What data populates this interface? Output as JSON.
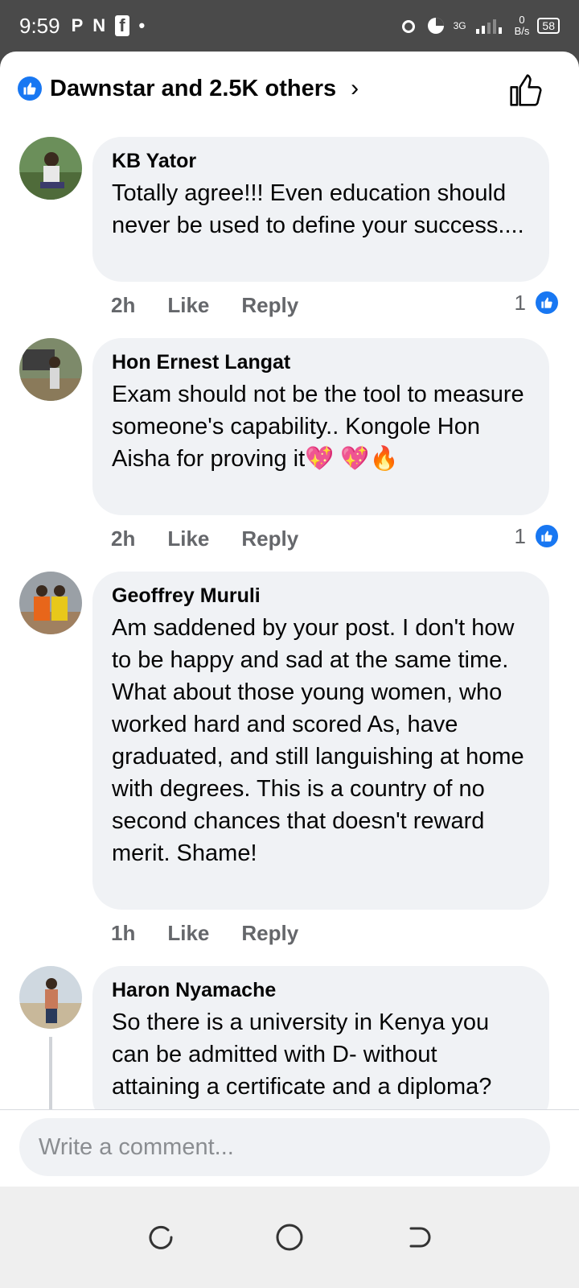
{
  "status_bar": {
    "time": "9:59",
    "left_icons": [
      "P",
      "N",
      "f",
      "•"
    ],
    "network": "3G",
    "speed_value": "0",
    "speed_unit": "B/s",
    "battery": "58"
  },
  "header": {
    "reactions_text": "Dawnstar and 2.5K others",
    "chevron": "›"
  },
  "comments": [
    {
      "author": "KB Yator",
      "text": "Totally agree!!! Even education should never be used to define your success....",
      "time": "2h",
      "like_label": "Like",
      "reply_label": "Reply",
      "reaction_count": "1"
    },
    {
      "author": "Hon Ernest Langat",
      "text": "Exam should not be the tool to measure someone's capability.. Kongole Hon Aisha for proving it💖 💖🔥",
      "time": "2h",
      "like_label": "Like",
      "reply_label": "Reply",
      "reaction_count": "1"
    },
    {
      "author": "Geoffrey Muruli",
      "text": "Am saddened by your post. I don't how to be happy and sad at the same time. What about those young women, who worked hard and scored As, have graduated, and still languishing at home with degrees. This is a country of no second chances that doesn't reward merit. Shame!",
      "time": "1h",
      "like_label": "Like",
      "reply_label": "Reply",
      "reaction_count": ""
    },
    {
      "author": "Haron Nyamache",
      "text": "So there is a university in Kenya you can be admitted with D- without attaining a certificate and a diploma?",
      "time": "",
      "like_label": "",
      "reply_label": "",
      "reaction_count": ""
    }
  ],
  "composer": {
    "placeholder": "Write a comment..."
  },
  "colors": {
    "accent": "#1877f2",
    "bubble": "#f0f2f5",
    "secondary_text": "#65676b"
  },
  "icons": [
    "like-icon",
    "chevron-right-icon",
    "thumbs-up-outline-icon",
    "recents-icon",
    "home-icon",
    "back-icon"
  ]
}
